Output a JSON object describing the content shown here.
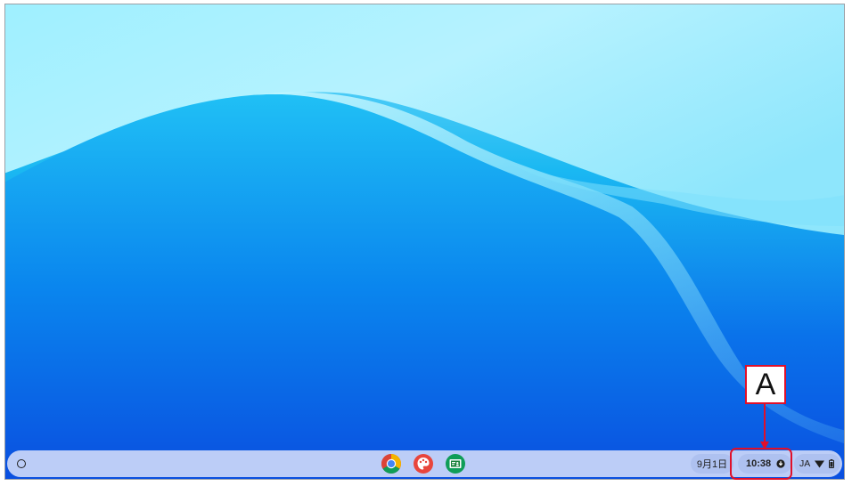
{
  "shelf": {
    "launcher_icon": "launcher-circle-icon",
    "apps": [
      {
        "name": "chrome",
        "icon": "chrome-icon"
      },
      {
        "name": "canvas",
        "icon": "palette-icon"
      },
      {
        "name": "classroom",
        "icon": "classroom-icon"
      }
    ],
    "date": "9月1日",
    "time": "10:38",
    "ime": "JA",
    "status_icons": [
      "download-icon",
      "wifi-icon",
      "battery-icon"
    ]
  },
  "annotation": {
    "label": "A",
    "color": "#e0102a"
  },
  "colors": {
    "shelf": "#bccdf7",
    "pill": "#aec1f0",
    "wallpaper_dark": "#0a57e5",
    "wallpaper_light": "#b9efff"
  }
}
